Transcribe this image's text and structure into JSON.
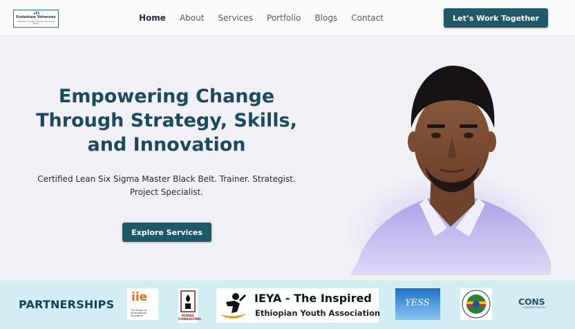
{
  "header": {
    "logo": {
      "name": "Endashaw Yohannes",
      "tagline": "Consultant, Strategic Planner, Educator & Mentor"
    },
    "nav": [
      {
        "label": "Home",
        "active": true
      },
      {
        "label": "About"
      },
      {
        "label": "Services"
      },
      {
        "label": "Portfolio"
      },
      {
        "label": "Blogs"
      },
      {
        "label": "Contact"
      }
    ],
    "cta_label": "Let’s Work Together"
  },
  "hero": {
    "title_lines": [
      "Empowering Change",
      "Through Strategy, Skills,",
      "and Innovation"
    ],
    "subtitle_lines": [
      "Certified Lean Six Sigma Master Black Belt. Trainer. Strategist.",
      "Project Specialist."
    ],
    "button_label": "Explore Services"
  },
  "partners": {
    "title": "PARTNERSHIPS",
    "iie": {
      "mark": "iie",
      "text": "The Power of International Education"
    },
    "kuraz": {
      "text": "KURAZ CONSULTING"
    },
    "ieya": {
      "title": "IEYA - The Inspired",
      "subtitle": "Ethiopian Youth Association"
    },
    "yess": {
      "text": "YESS"
    },
    "cons": {
      "text": "CONS",
      "sub": "CONSTRUCTION PLC"
    }
  },
  "colors": {
    "accent": "#1f5868",
    "heading": "#1b4a5e",
    "partners_bg": "#d3eef3",
    "iie_orange": "#e86a1a"
  }
}
